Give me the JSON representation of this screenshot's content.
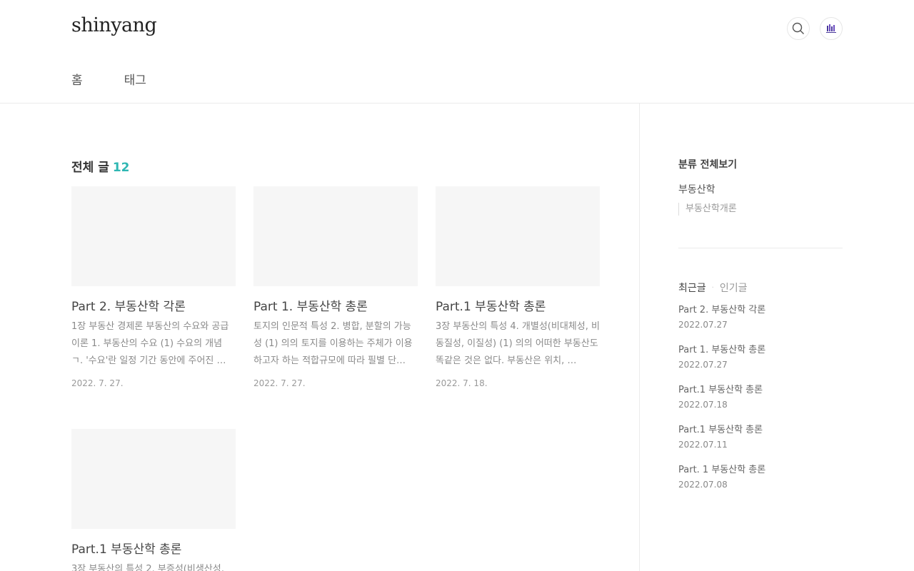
{
  "header": {
    "logo": "shinyang",
    "nav": [
      "홈",
      "태그"
    ]
  },
  "main": {
    "title": "전체 글",
    "count": "12",
    "posts": [
      {
        "title": "Part 2. 부동산학 각론",
        "excerpt": "1장 부동산 경제론 부동산의 수요와 공급 이론 1. 부동산의 수요 (1) 수요의 개념 ㄱ. '수요'란 일정 기간 동안에 주어진 …",
        "date": "2022. 7. 27."
      },
      {
        "title": "Part 1. 부동산학 총론",
        "excerpt": "토지의 인문적 특성 2. 병합, 분할의 가능성 (1) 의의 토지를 이용하는 주체가 이용하고자 하는 적합규모에 따라 필별 단…",
        "date": "2022. 7. 27."
      },
      {
        "title": "Part.1 부동산학 총론",
        "excerpt": "3장 부동산의 특성 4. 개별성(비대체성, 비동질성, 이질성) (1) 의의 어떠한 부동산도 똑같은 것은 없다. 부동산은 위치, …",
        "date": "2022. 7. 18."
      },
      {
        "title": "Part.1 부동산학 총론",
        "excerpt": "3장 부동산의 특성 2. 부증성(비생산성,",
        "date": ""
      }
    ]
  },
  "sidebar": {
    "category_head": "분류 전체보기",
    "category_1": "부동산학",
    "category_2": "부동산학개론",
    "tab_recent": "최근글",
    "tab_popular": "인기글",
    "recent": [
      {
        "title": "Part 2. 부동산학 각론",
        "date": "2022.07.27"
      },
      {
        "title": "Part 1. 부동산학 총론",
        "date": "2022.07.27"
      },
      {
        "title": "Part.1 부동산학 총론",
        "date": "2022.07.18"
      },
      {
        "title": "Part.1 부동산학 총론",
        "date": "2022.07.11"
      },
      {
        "title": "Part. 1 부동산학 총론",
        "date": "2022.07.08"
      }
    ]
  },
  "icons": {
    "search": "search-icon",
    "profile": "profile-avatar-icon"
  },
  "colors": {
    "accent": "#2fb7b3",
    "thumb": "#f6f6f6"
  }
}
